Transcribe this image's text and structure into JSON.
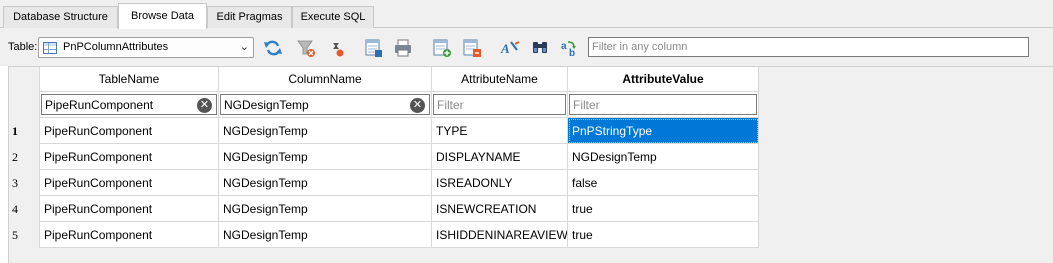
{
  "tabs": [
    {
      "label": "Database Structure"
    },
    {
      "label": "Browse Data"
    },
    {
      "label": "Edit Pragmas"
    },
    {
      "label": "Execute SQL"
    }
  ],
  "active_tab": "Browse Data",
  "toolbar": {
    "table_label": "Table:",
    "table_value": "PnPColumnAttributes",
    "filter_placeholder": "Filter in any column",
    "buttons": [
      "refresh-icon",
      "clear-filters-icon",
      "sort-clear-icon",
      "save-table-icon",
      "print-icon",
      "insert-record-icon",
      "delete-record-icon",
      "set-encoding-icon",
      "find-icon",
      "replace-icon"
    ]
  },
  "grid": {
    "columns": [
      "TableName",
      "ColumnName",
      "AttributeName",
      "AttributeValue"
    ],
    "sorted_column": "AttributeValue",
    "filters": [
      {
        "value": "PipeRunComponent",
        "placeholder": ""
      },
      {
        "value": "NGDesignTemp",
        "placeholder": ""
      },
      {
        "value": "",
        "placeholder": "Filter"
      },
      {
        "value": "",
        "placeholder": "Filter"
      }
    ],
    "rows": [
      {
        "num": "1",
        "cells": [
          "PipeRunComponent",
          "NGDesignTemp",
          "TYPE",
          "PnPStringType"
        ]
      },
      {
        "num": "2",
        "cells": [
          "PipeRunComponent",
          "NGDesignTemp",
          "DISPLAYNAME",
          "NGDesignTemp"
        ]
      },
      {
        "num": "3",
        "cells": [
          "PipeRunComponent",
          "NGDesignTemp",
          "ISREADONLY",
          "false"
        ]
      },
      {
        "num": "4",
        "cells": [
          "PipeRunComponent",
          "NGDesignTemp",
          "ISNEWCREATION",
          "true"
        ]
      },
      {
        "num": "5",
        "cells": [
          "PipeRunComponent",
          "NGDesignTemp",
          "ISHIDDENINAREAVIEW",
          "true"
        ]
      }
    ],
    "selected_cell": {
      "row": 1,
      "column": "AttributeValue"
    }
  },
  "colors": {
    "selection": "#0078d7",
    "background": "#f0f0f0"
  }
}
